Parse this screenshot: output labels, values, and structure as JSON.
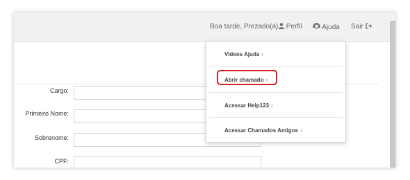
{
  "header": {
    "greeting": "Boa tarde, Prezado(a).",
    "perfil_label": "Perfil",
    "ajuda_label": "Ajuda",
    "sair_label": "Sair"
  },
  "form": {
    "fields": [
      {
        "label": "Cargo:",
        "value": ""
      },
      {
        "label": "Primeiro Nome:",
        "value": ""
      },
      {
        "label": "Sobrenome:",
        "value": ""
      },
      {
        "label": "CPF:",
        "value": ""
      }
    ]
  },
  "help_menu": {
    "items": [
      {
        "label": "Videos Ajuda",
        "chevron": "›"
      },
      {
        "label": "Abrir chamado",
        "chevron": "›"
      },
      {
        "label": "Acessar Help123",
        "chevron": "›"
      },
      {
        "label": "Acessar Chamados Antigos",
        "chevron": "›"
      }
    ],
    "highlighted_item": "Abrir chamado",
    "highlight_color": "#d81e1e"
  },
  "icons": [
    "user-icon",
    "helpdesk-icon",
    "exit-icon",
    "chevron-right-icon"
  ]
}
